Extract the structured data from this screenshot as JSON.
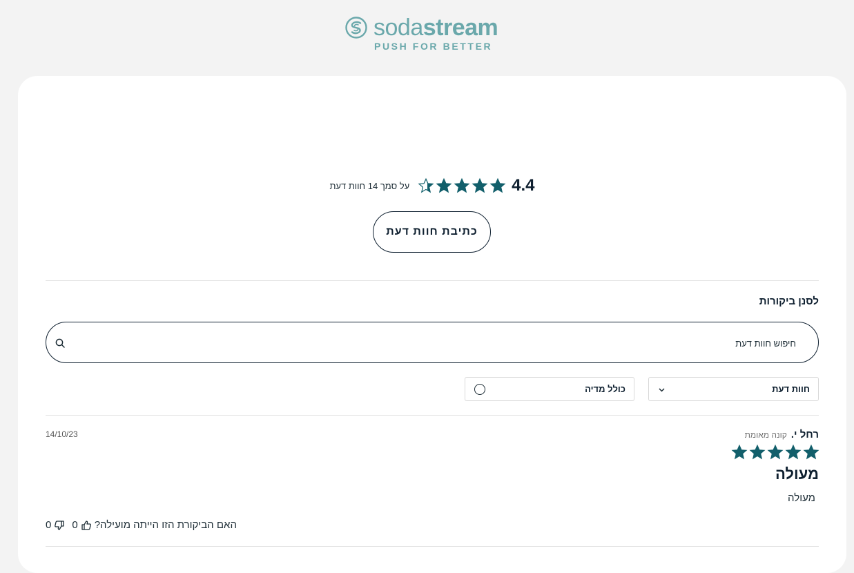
{
  "brand": {
    "wordmark_light": "soda",
    "wordmark_bold": "stream",
    "tagline": "PUSH FOR BETTER",
    "color": "#6aa8ab"
  },
  "colors": {
    "star": "#125f6b",
    "text": "#0f2030",
    "page_bg": "#f3f3f3"
  },
  "summary": {
    "average": "4.4",
    "average_value": 4.4,
    "max_stars": 5,
    "count_text": "על סמך 14 חוות דעת"
  },
  "write_review_label": "כתיבת חוות דעת",
  "filters": {
    "title": "לסנן ביקורות",
    "search_placeholder": "חיפוש חוות דעת",
    "opinion_select": "חוות דעת",
    "media_toggle": "כולל מדיה"
  },
  "reviews": [
    {
      "author": "רחל י.",
      "verified": "קונה מאומת",
      "date": "14/10/23",
      "rating": 5,
      "title": "מעולה",
      "body": "מעולה",
      "helpful_question": "האם הביקורת הזו הייתה מועילה?",
      "thumbs_up": "0",
      "thumbs_down": "0"
    }
  ],
  "icons": [
    "sodastream-logo-icon",
    "star-icon",
    "search-icon",
    "chevron-down-icon",
    "thumbs-up-icon",
    "thumbs-down-icon"
  ]
}
